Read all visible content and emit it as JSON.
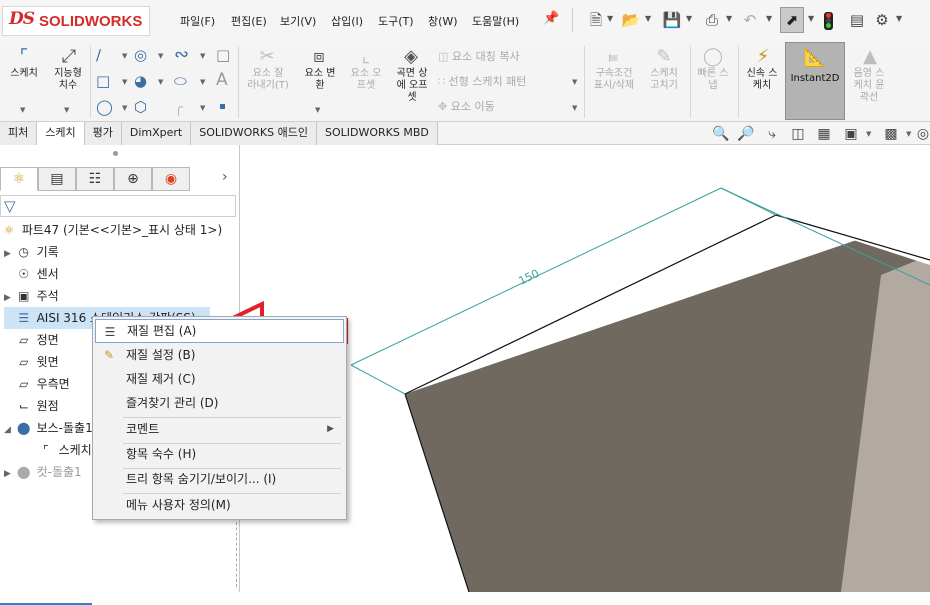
{
  "app": {
    "logo_ds": "DS",
    "logo_text": "SOLIDWORKS"
  },
  "menu": [
    "파일(F)",
    "편집(E)",
    "보기(V)",
    "삽입(I)",
    "도구(T)",
    "창(W)",
    "도움말(H)"
  ],
  "quick_access": {
    "new": "new-document-icon",
    "open": "open-icon",
    "save": "save-icon",
    "print": "print-icon",
    "undo": "undo-icon",
    "select": "select-pointer-icon",
    "rebuild": "rebuild-traffic-light-icon",
    "file_properties": "file-properties-icon",
    "options": "options-gear-icon"
  },
  "ribbon": {
    "sketch": "스케치",
    "smart_dimension": [
      "지능형",
      "치수"
    ],
    "sketch_fillet": [
      "요소 잘",
      "라내기(T)"
    ],
    "convert_entities": [
      "요소 변",
      "환"
    ],
    "offset_entities": [
      "요소 오",
      "프셋"
    ],
    "surface_offset": [
      "곡면 상",
      "에 오프",
      "셋"
    ],
    "mirror_entities": "요소 대칭 복사",
    "linear_pattern": "선형 스케치 패턴",
    "move_entities": "요소 이동",
    "relations": [
      "구속조건",
      "표시/삭제"
    ],
    "repair_sketch": [
      "스케치",
      "고치기"
    ],
    "quick_snaps": [
      "빠른 스",
      "냅"
    ],
    "rapid_sketch": [
      "신속 스",
      "케치"
    ],
    "instant2d": "Instant2D",
    "shaded_sketch": [
      "음영 스",
      "케치 윤",
      "곽선"
    ]
  },
  "tabs": [
    {
      "label": "피처",
      "active": false
    },
    {
      "label": "스케치",
      "active": true
    },
    {
      "label": "평가",
      "active": false
    },
    {
      "label": "DimXpert",
      "active": false
    },
    {
      "label": "SOLIDWORKS 애드인",
      "active": false
    },
    {
      "label": "SOLIDWORKS MBD",
      "active": false
    }
  ],
  "tree": {
    "root": "파트47  (기본<<기본>_표시 상태 1>)",
    "items": [
      {
        "label": "기록",
        "icon": "history-folder-icon",
        "expandable": true
      },
      {
        "label": "센서",
        "icon": "sensor-icon",
        "expandable": false
      },
      {
        "label": "주석",
        "icon": "annotation-icon",
        "expandable": true
      },
      {
        "label": "AISI 316 스테인리스 강판(SS)",
        "icon": "material-icon",
        "expandable": false,
        "selected": true
      },
      {
        "label": "정면",
        "icon": "plane-icon",
        "expandable": false
      },
      {
        "label": "윗면",
        "icon": "plane-icon",
        "expandable": false
      },
      {
        "label": "우측면",
        "icon": "plane-icon",
        "expandable": false
      },
      {
        "label": "원점",
        "icon": "origin-icon",
        "expandable": false
      },
      {
        "label": "보스-돌출1",
        "icon": "extrude-boss-icon",
        "expandable": true,
        "expanded": true
      },
      {
        "label": "스케치1",
        "icon": "sketch-icon",
        "expandable": false,
        "child": true
      },
      {
        "label": "컷-돌출1",
        "icon": "extrude-cut-icon",
        "expandable": true,
        "dim": true
      }
    ]
  },
  "context_menu": {
    "items": [
      {
        "label": "재질 편집 (A)",
        "icon": "edit-material-icon",
        "highlighted": true
      },
      {
        "label": "재질 설정 (B)",
        "icon": "set-material-icon"
      },
      {
        "label": "재질 제거 (C)",
        "icon": ""
      },
      {
        "label": "즐겨찾기 관리 (D)",
        "icon": ""
      },
      {
        "label": "코멘트",
        "icon": "",
        "submenu": true
      },
      {
        "label": "항목 숙수 (H)",
        "icon": ""
      },
      {
        "label": "트리 항목 숨기기/보이기... (I)",
        "icon": ""
      },
      {
        "label": "메뉴 사용자 정의(M)",
        "icon": ""
      }
    ]
  },
  "annotation": {
    "arrow_color": "#e0202a"
  },
  "dimension": {
    "label": "150"
  },
  "colors": {
    "dimension": "#3aa0a0",
    "box_front": "#6f6960",
    "box_right": "#b2aaa0",
    "accent_red": "#e0202a"
  }
}
